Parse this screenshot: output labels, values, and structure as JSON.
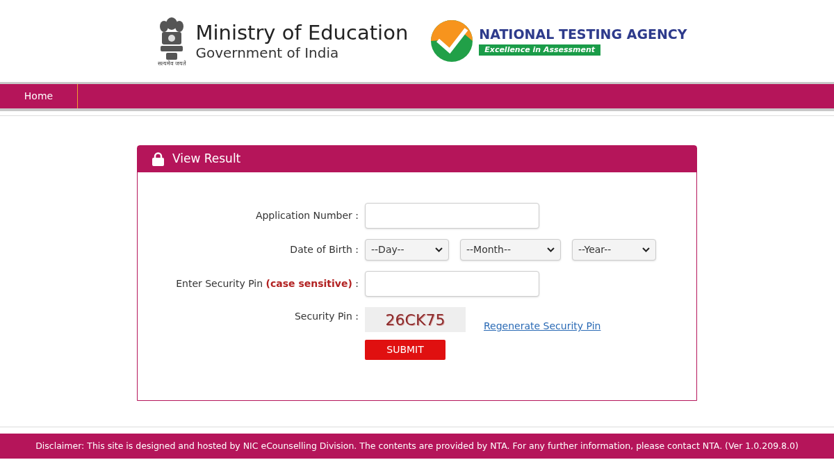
{
  "header": {
    "emblem_motto": "सत्यमेव जयते",
    "ministry_title": "Ministry of Education",
    "ministry_subtitle": "Government of India",
    "agency_name": "NATIONAL TESTING AGENCY",
    "agency_tagline": "Excellence in Assessment"
  },
  "nav": [
    {
      "label": "Home",
      "selected": false
    }
  ],
  "card": {
    "title": "View Result",
    "fields": [
      {
        "kind": "input",
        "label": "Application Number :"
      },
      {
        "kind": "selects",
        "label": "Date of Birth :",
        "selects": [
          "--Day--",
          "--Month--",
          "--Year--"
        ]
      },
      {
        "kind": "input",
        "label": "Enter Security Pin **(case sensitive)** :"
      },
      {
        "kind": "captcha",
        "label": "Security Pin :",
        "code": "26CK75",
        "link": "Regenerate Security Pin"
      }
    ],
    "submit": "SUBMIT"
  },
  "footer": "Disclaimer: This site is designed and hosted by NIC eCounselling Division. The contents are provided by NTA. For any further information, please contact NTA. (Ver 1.0.209.8.0)"
}
